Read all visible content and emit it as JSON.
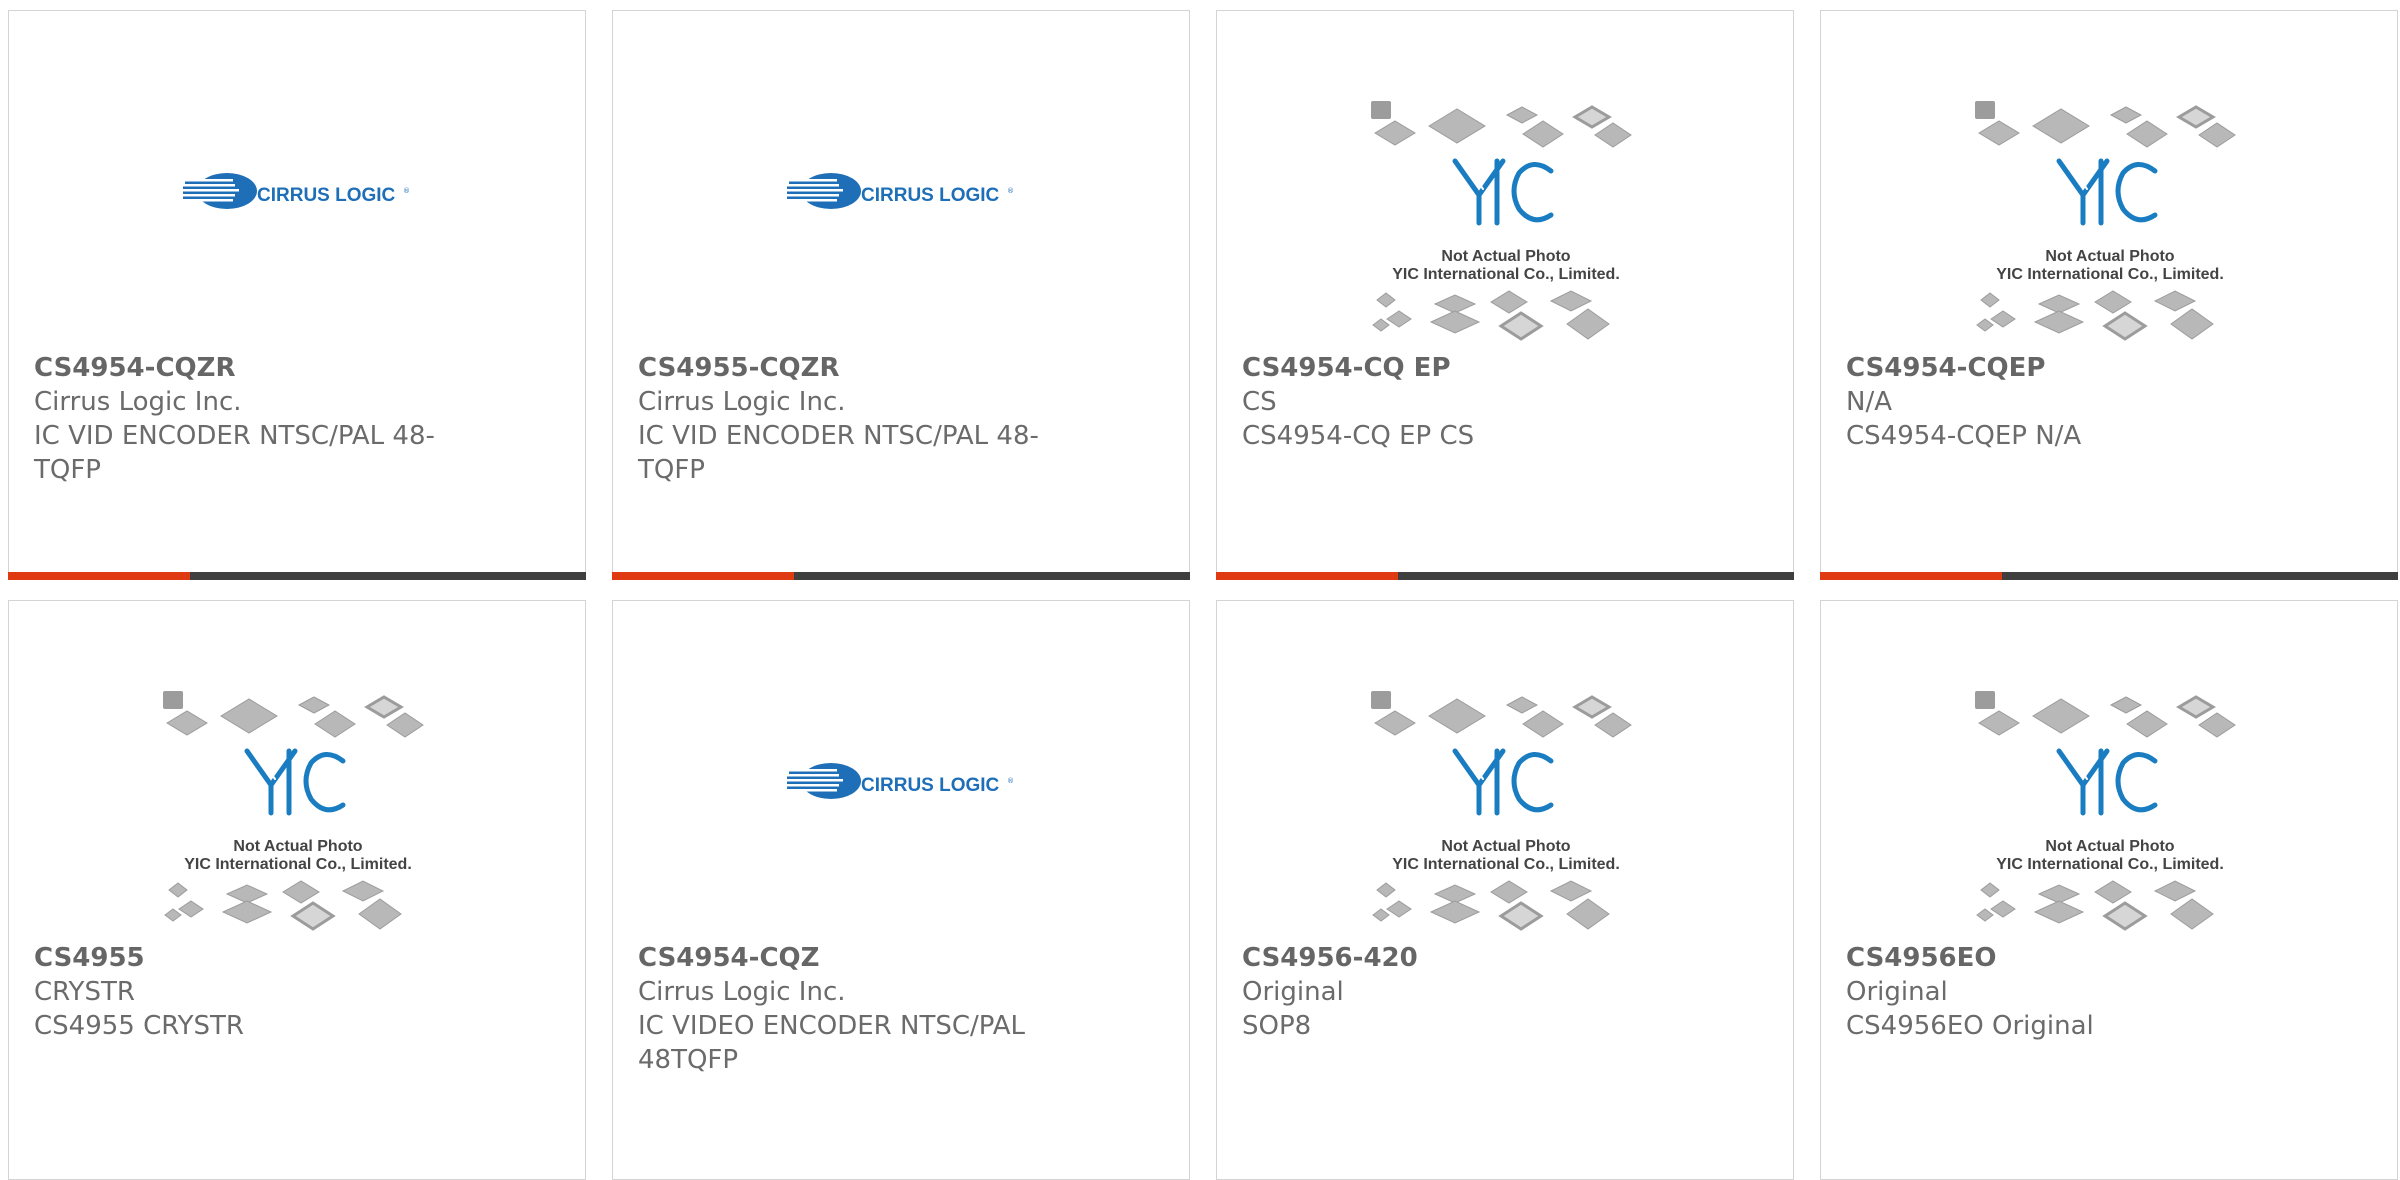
{
  "colors": {
    "accent": "#e03a12",
    "bar": "#3f3f3f",
    "cirrus_blue": "#1e6fb8",
    "yic_blue": "#1a7cc1",
    "text": "#6b6b6b"
  },
  "placeholder_image": {
    "line1": "Not Actual Photo",
    "line2": "YIC International Co., Limited.",
    "logo_text": "YIC"
  },
  "cirrus_logo": {
    "text": "CIRRUS LOGIC"
  },
  "products": [
    {
      "part_number": "CS4954-CQZR",
      "manufacturer": "Cirrus Logic Inc.",
      "description": "IC VID ENCODER NTSC/PAL 48-TQFP",
      "image": "cirrus-logo"
    },
    {
      "part_number": "CS4955-CQZR",
      "manufacturer": "Cirrus Logic Inc.",
      "description": "IC VID ENCODER NTSC/PAL 48-TQFP",
      "image": "cirrus-logo"
    },
    {
      "part_number": "CS4954-CQ EP",
      "manufacturer": "CS",
      "description": "CS4954-CQ EP CS",
      "image": "yic-placeholder"
    },
    {
      "part_number": "CS4954-CQEP",
      "manufacturer": "N/A",
      "description": "CS4954-CQEP N/A",
      "image": "yic-placeholder"
    },
    {
      "part_number": "CS4955",
      "manufacturer": "CRYSTR",
      "description": "CS4955 CRYSTR",
      "image": "yic-placeholder"
    },
    {
      "part_number": "CS4954-CQZ",
      "manufacturer": "Cirrus Logic Inc.",
      "description": "IC VIDEO ENCODER NTSC/PAL 48TQFP",
      "image": "cirrus-logo"
    },
    {
      "part_number": "CS4956-420",
      "manufacturer": "Original",
      "description": "SOP8",
      "image": "yic-placeholder"
    },
    {
      "part_number": "CS4956EO",
      "manufacturer": "Original",
      "description": "CS4956EO Original",
      "image": "yic-placeholder"
    }
  ]
}
